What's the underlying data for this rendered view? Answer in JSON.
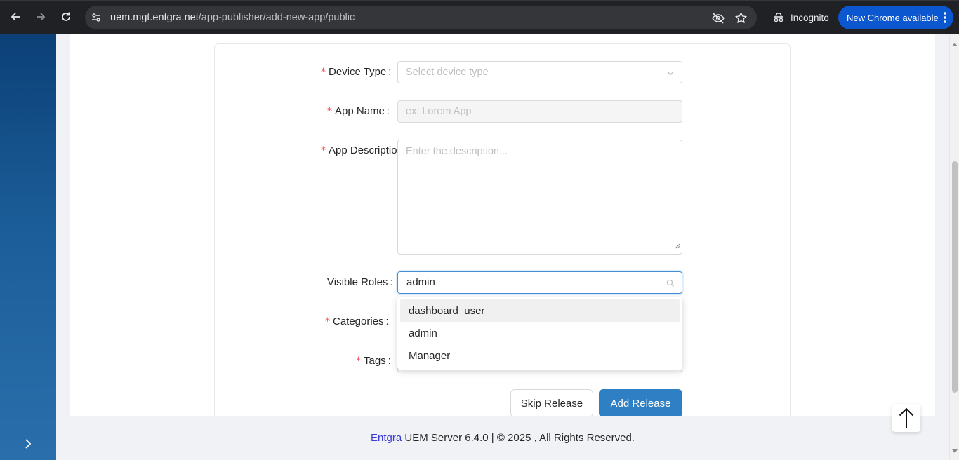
{
  "browser": {
    "url_host": "uem.mgt.entgra.net",
    "url_path": "/app-publisher/add-new-app/public",
    "incognito_label": "Incognito",
    "update_label": "New Chrome available"
  },
  "form": {
    "device_type": {
      "label": "Device Type",
      "placeholder": "Select device type",
      "required": true
    },
    "app_name": {
      "label": "App Name",
      "placeholder": "ex: Lorem App",
      "required": true
    },
    "app_description": {
      "label": "App Description",
      "placeholder": "Enter the description...",
      "required": true
    },
    "visible_roles": {
      "label": "Visible Roles",
      "value": "admin",
      "required": false
    },
    "categories": {
      "label": "Categories",
      "required": true
    },
    "tags": {
      "label": "Tags",
      "required": true
    },
    "required_marker": "*",
    "colon": ":"
  },
  "roles_dropdown": {
    "options": [
      "dashboard_user",
      "admin",
      "Manager"
    ],
    "active_index": 0
  },
  "buttons": {
    "skip_release": "Skip Release",
    "add_release": "Add Release"
  },
  "footer": {
    "brand": "Entgra",
    "text": " UEM Server 6.4.0 | © 2025 , All Rights Reserved."
  },
  "colors": {
    "sidebar": "#1b5d98",
    "primary": "#2e7fc4",
    "required": "#ff4d4f",
    "chrome_update": "#0b57d0"
  }
}
